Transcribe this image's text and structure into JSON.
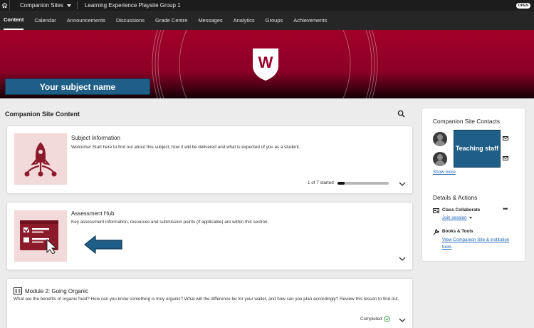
{
  "topbar": {
    "sites_label": "Companion Sites",
    "course_title": "Learning Experience Playsite Group 1",
    "status_badge": "OPEN"
  },
  "nav": {
    "items": [
      "Content",
      "Calendar",
      "Announcements",
      "Discussions",
      "Grade Centre",
      "Messages",
      "Analytics",
      "Groups",
      "Achievements"
    ],
    "active": "Content"
  },
  "banner": {
    "logo_letter": "W",
    "subject_name": "Your subject name"
  },
  "content": {
    "title": "Companion Site Content",
    "cards": [
      {
        "title": "Subject Information",
        "description": "Welcome! Start here to find out about this subject, how it will be delivered and what is expected of you as a student.",
        "progress_text": "1 of 7 started",
        "progress_fraction": 0.14
      },
      {
        "title": "Assessment Hub",
        "description": "Key assessment information, resources and submission points (if applicable) are within this section."
      },
      {
        "title": "Module 2: Going Organic",
        "description": "What are the benefits of organic food? How can you know something is truly organic? What will the difference be for your wallet, and how can you plan accordingly? Review this lesson to find out.",
        "status": "Completed"
      }
    ]
  },
  "sidebar": {
    "contacts_title": "Companion Site Contacts",
    "teaching_staff_label": "Teaching staff",
    "show_more": "Show more",
    "details_title": "Details & Actions",
    "class_collaborate_label": "Class Collaborate",
    "join_session": "Join session",
    "books_tools_label": "Books & Tools",
    "books_tools_link": "View Companion Site & institution tools"
  },
  "colors": {
    "brand_red": "#9a0029",
    "annotation_blue": "#1f5f87",
    "link_blue": "#1a63b8",
    "completed_green": "#2e9c3a"
  }
}
